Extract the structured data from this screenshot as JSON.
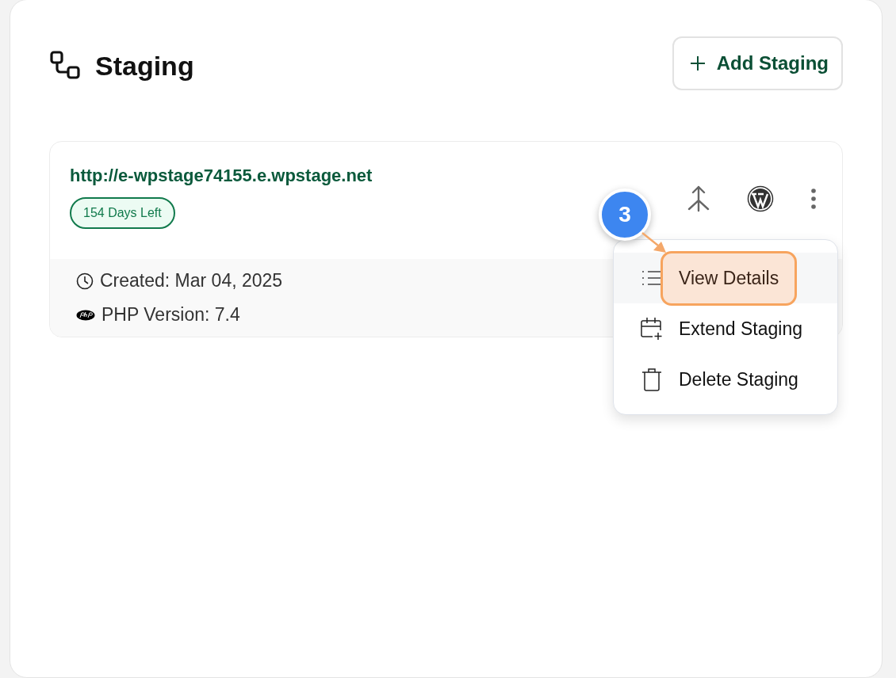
{
  "header": {
    "title": "Staging",
    "add_button": "Add Staging"
  },
  "staging_card": {
    "url": "http://e-wpstage74155.e.wpstage.net",
    "badge": "154 Days Left",
    "created": "Created: Mar 04, 2025",
    "php_version": "PHP Version: 7.4"
  },
  "menu": {
    "items": [
      {
        "label": "View Details",
        "kind": "details",
        "hovered": true,
        "highlighted": true
      },
      {
        "label": "Extend Staging",
        "kind": "extend",
        "hovered": false,
        "highlighted": false
      },
      {
        "label": "Delete Staging",
        "kind": "delete",
        "hovered": false,
        "highlighted": false
      }
    ]
  },
  "callout": {
    "step": "3"
  }
}
